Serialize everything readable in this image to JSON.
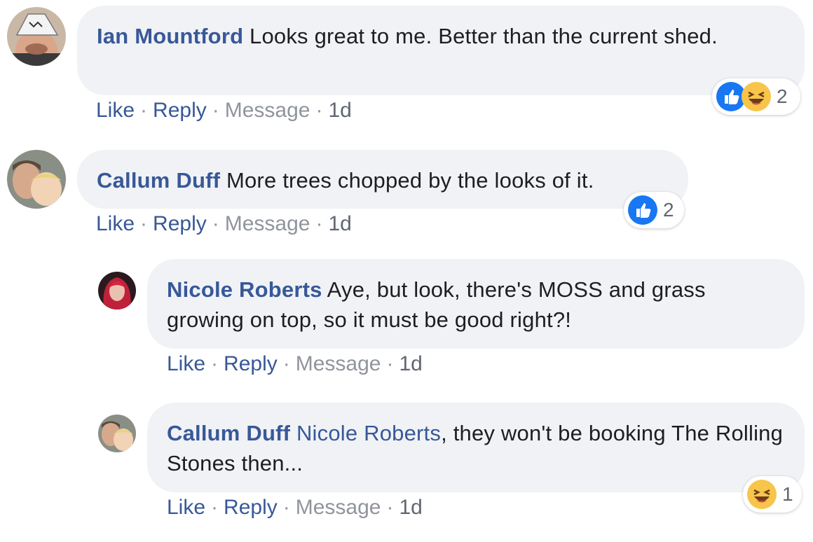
{
  "comments": [
    {
      "author": "Ian Mountford",
      "text": " Looks great to me. Better than the current shed.",
      "actions": {
        "like": "Like",
        "reply": "Reply",
        "message": "Message",
        "time": "1d"
      },
      "reactions": {
        "icons": [
          "like-icon",
          "haha-icon"
        ],
        "count": "2"
      }
    },
    {
      "author": "Callum Duff",
      "text": " More trees chopped by the looks of it.",
      "actions": {
        "like": "Like",
        "reply": "Reply",
        "message": "Message",
        "time": "1d"
      },
      "reactions": {
        "icons": [
          "like-icon"
        ],
        "count": "2"
      }
    }
  ],
  "replies": [
    {
      "author": "Nicole Roberts",
      "text": " Aye, but look, there's MOSS and grass growing on top, so it must be good right?!",
      "actions": {
        "like": "Like",
        "reply": "Reply",
        "message": "Message",
        "time": "1d"
      }
    },
    {
      "author": "Callum Duff",
      "mention": "Nicole Roberts",
      "text": ", they won't be booking The Rolling Stones then...",
      "actions": {
        "like": "Like",
        "reply": "Reply",
        "message": "Message",
        "time": "1d"
      },
      "reactions": {
        "icons": [
          "haha-icon"
        ],
        "count": "1"
      }
    }
  ],
  "separator": "·",
  "colors": {
    "link": "#385898",
    "bubble": "#f0f2f5",
    "like_blue": "#1877f2",
    "haha_yellow": "#f7c54a"
  }
}
